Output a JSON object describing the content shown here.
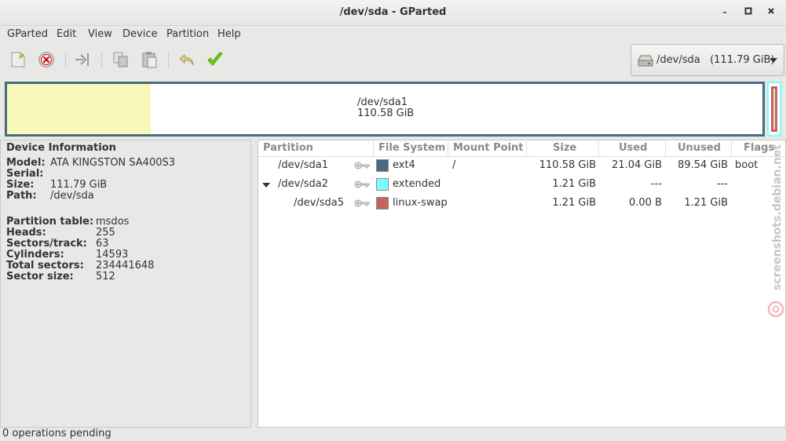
{
  "window": {
    "title": "/dev/sda - GParted"
  },
  "menubar": {
    "items": [
      "GParted",
      "Edit",
      "View",
      "Device",
      "Partition",
      "Help"
    ]
  },
  "toolbar": {
    "device_selector": "/dev/sda   (111.79 GiB)"
  },
  "disk_graphic": {
    "name": "/dev/sda1",
    "size": "110.58 GiB",
    "used_fraction": 0.19
  },
  "device_info": {
    "heading": "Device Information",
    "rows": [
      {
        "key": "Model:",
        "value": "ATA KINGSTON SA400S3"
      },
      {
        "key": "Serial:",
        "value": ""
      },
      {
        "key": "Size:",
        "value": "111.79 GiB"
      },
      {
        "key": "Path:",
        "value": "/dev/sda"
      },
      {
        "key": "Partition table:",
        "value": "msdos"
      },
      {
        "key": "Heads:",
        "value": "255"
      },
      {
        "key": "Sectors/track:",
        "value": "63"
      },
      {
        "key": "Cylinders:",
        "value": "14593"
      },
      {
        "key": "Total sectors:",
        "value": "234441648"
      },
      {
        "key": "Sector size:",
        "value": "512"
      }
    ]
  },
  "partitions": {
    "columns": [
      "Partition",
      "File System",
      "Mount Point",
      "Size",
      "Used",
      "Unused",
      "Flags"
    ],
    "rows": [
      {
        "partition": "/dev/sda1",
        "filesystem": "ext4",
        "fs_color": "#4b6983",
        "mount": "/",
        "size": "110.58 GiB",
        "used": "21.04 GiB",
        "unused": "89.54 GiB",
        "flags": "boot"
      },
      {
        "partition": "/dev/sda2",
        "filesystem": "extended",
        "fs_color": "#7dfcfe",
        "mount": "",
        "size": "1.21 GiB",
        "used": "---",
        "unused": "---",
        "flags": ""
      },
      {
        "partition": "/dev/sda5",
        "filesystem": "linux-swap",
        "fs_color": "#c1665a",
        "mount": "",
        "size": "1.21 GiB",
        "used": "0.00 B",
        "unused": "1.21 GiB",
        "flags": ""
      }
    ]
  },
  "status": {
    "text": "0 operations pending"
  },
  "watermark": {
    "text": "screenshots.debian.net"
  }
}
